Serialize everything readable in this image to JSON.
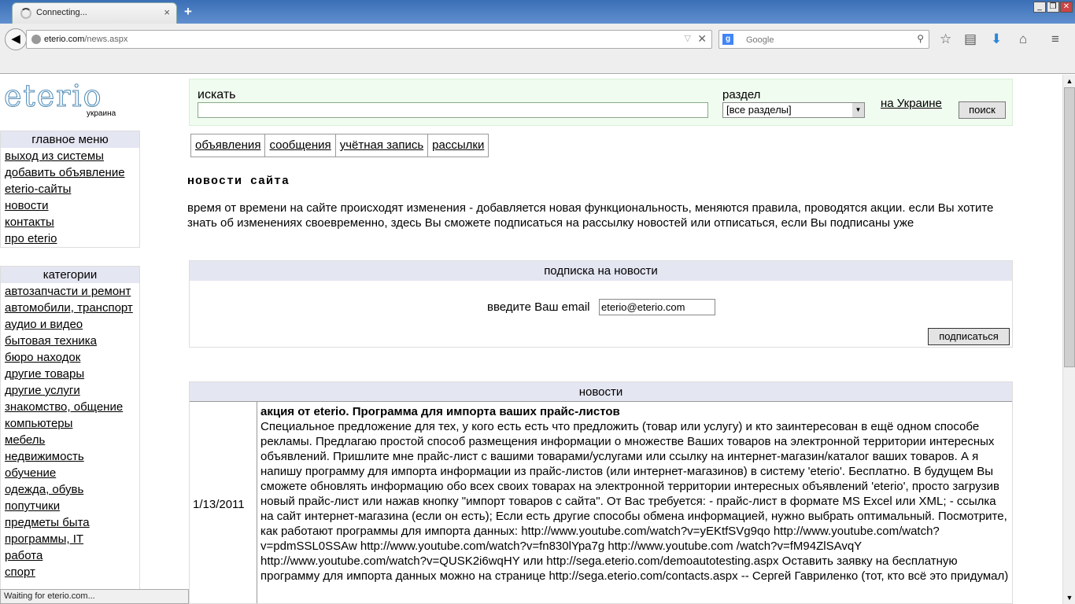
{
  "browser": {
    "tab_title": "Connecting...",
    "new_tab": "+",
    "url_host": "eterio.com",
    "url_path": "/news.aspx",
    "search_engine": "Google",
    "status": "Waiting for eterio.com..."
  },
  "logo": {
    "word": "eterio",
    "country": "украина"
  },
  "main_menu": {
    "title": "главное меню",
    "items": [
      "выход из системы",
      "добавить объявление",
      "eterio-сайты",
      "новости",
      "контакты",
      "про eterio"
    ]
  },
  "categories": {
    "title": "категории",
    "items": [
      "автозапчасти и ремонт",
      "автомобили, транспорт",
      "аудио и видео",
      "бытовая техника",
      "бюро находок",
      "другие товары",
      "другие услуги",
      "знакомство, общение",
      "компьютеры",
      "мебель",
      "недвижимость",
      "обучение",
      "одежда, обувь",
      "попутчики",
      "предметы быта",
      "программы, IT",
      "работа",
      "спорт"
    ]
  },
  "search": {
    "label": "искать",
    "section_label": "раздел",
    "section_value": "[все разделы]",
    "region_link": "на Украине",
    "button": "поиск"
  },
  "tabs": [
    "объявления",
    "сообщения",
    "учётная запись",
    "рассылки"
  ],
  "news_page": {
    "title": "новости сайта",
    "intro": "время от времени на сайте происходят изменения - добавляется новая функциональность, меняются правила, проводятся акции. если Вы хотите знать об изменениях своевременно, здесь Вы сможете подписаться на рассылку новостей или отписаться, если Вы подписаны уже"
  },
  "subscribe": {
    "header": "подписка на новости",
    "email_label": "введите Ваш email",
    "email_value": "eterio@eterio.com",
    "button": "подписаться"
  },
  "news": {
    "header": "новости",
    "items": [
      {
        "date": "1/13/2011",
        "title": "акция от eterio. Программа для импорта ваших прайс-листов",
        "text": "Специальное предложение для тех, у кого есть есть что предложить (товар или услугу) и кто заинтересован в ещё одном способе рекламы. Предлагаю простой способ размещения информации о множестве Ваших товаров на электронной территории интересных объявлений. Пришлите мне прайс-лист с вашими товарами/услугами или ссылку на интернет-магазин/каталог ваших товаров. А я напишу программу для импорта информации из прайс-листов (или интернет-магазинов) в систему 'eterio'. Бесплатно. В будущем Вы сможете обновлять информацию обо всех своих товарах на электронной территории интересных объявлений 'eterio', просто загрузив новый прайс-лист или нажав кнопку \"импорт товаров с сайта\". От Вас требуется: - прайс-лист в формате MS Excel или XML; - ссылка на сайт интернет-магазина (если он есть); Если есть другие способы обмена информацией, нужно выбрать оптимальный. Посмотрите, как работают программы для импорта данных: http://www.youtube.com/watch?v=yEKtfSVg9qo http://www.youtube.com/watch?v=pdmSSL0SSAw http://www.youtube.com/watch?v=fn830lYpa7g http://www.youtube.com /watch?v=fM94ZlSAvqY http://www.youtube.com/watch?v=QUSK2i6wqHY или http://sega.eterio.com/demoautotesting.aspx Оставить заявку на бесплатную программу для импорта данных можно на странице http://sega.eterio.com/contacts.aspx -- Сергей Гавриленко (тот, кто всё это придумал)"
      }
    ]
  }
}
